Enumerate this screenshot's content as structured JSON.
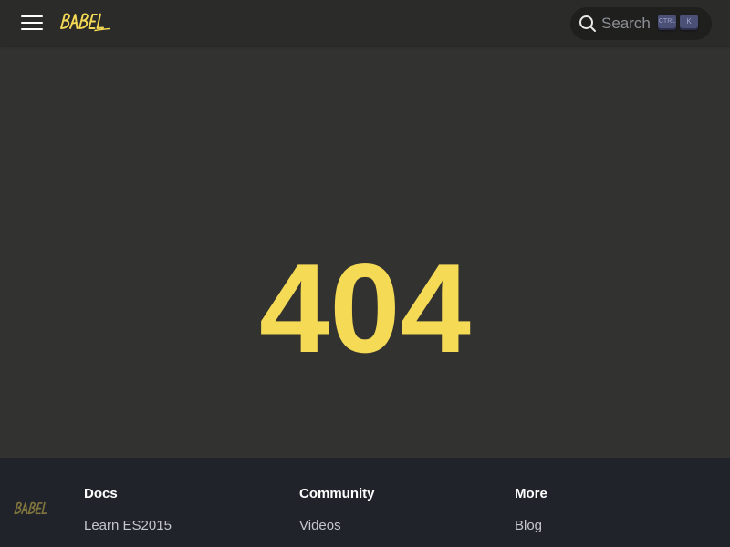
{
  "brand": {
    "logo_text": "BABEL",
    "accent_color": "#f5da55"
  },
  "navbar": {
    "menu_icon": "hamburger-menu-icon",
    "search": {
      "icon": "search-icon",
      "placeholder": "Search",
      "shortcut_keys": [
        "CTRL",
        "K"
      ]
    }
  },
  "main": {
    "error_code": "404"
  },
  "footer": {
    "logo_text": "BABEL",
    "columns": [
      {
        "heading": "Docs",
        "links": [
          "Learn ES2015"
        ]
      },
      {
        "heading": "Community",
        "links": [
          "Videos"
        ]
      },
      {
        "heading": "More",
        "links": [
          "Blog"
        ]
      }
    ]
  }
}
